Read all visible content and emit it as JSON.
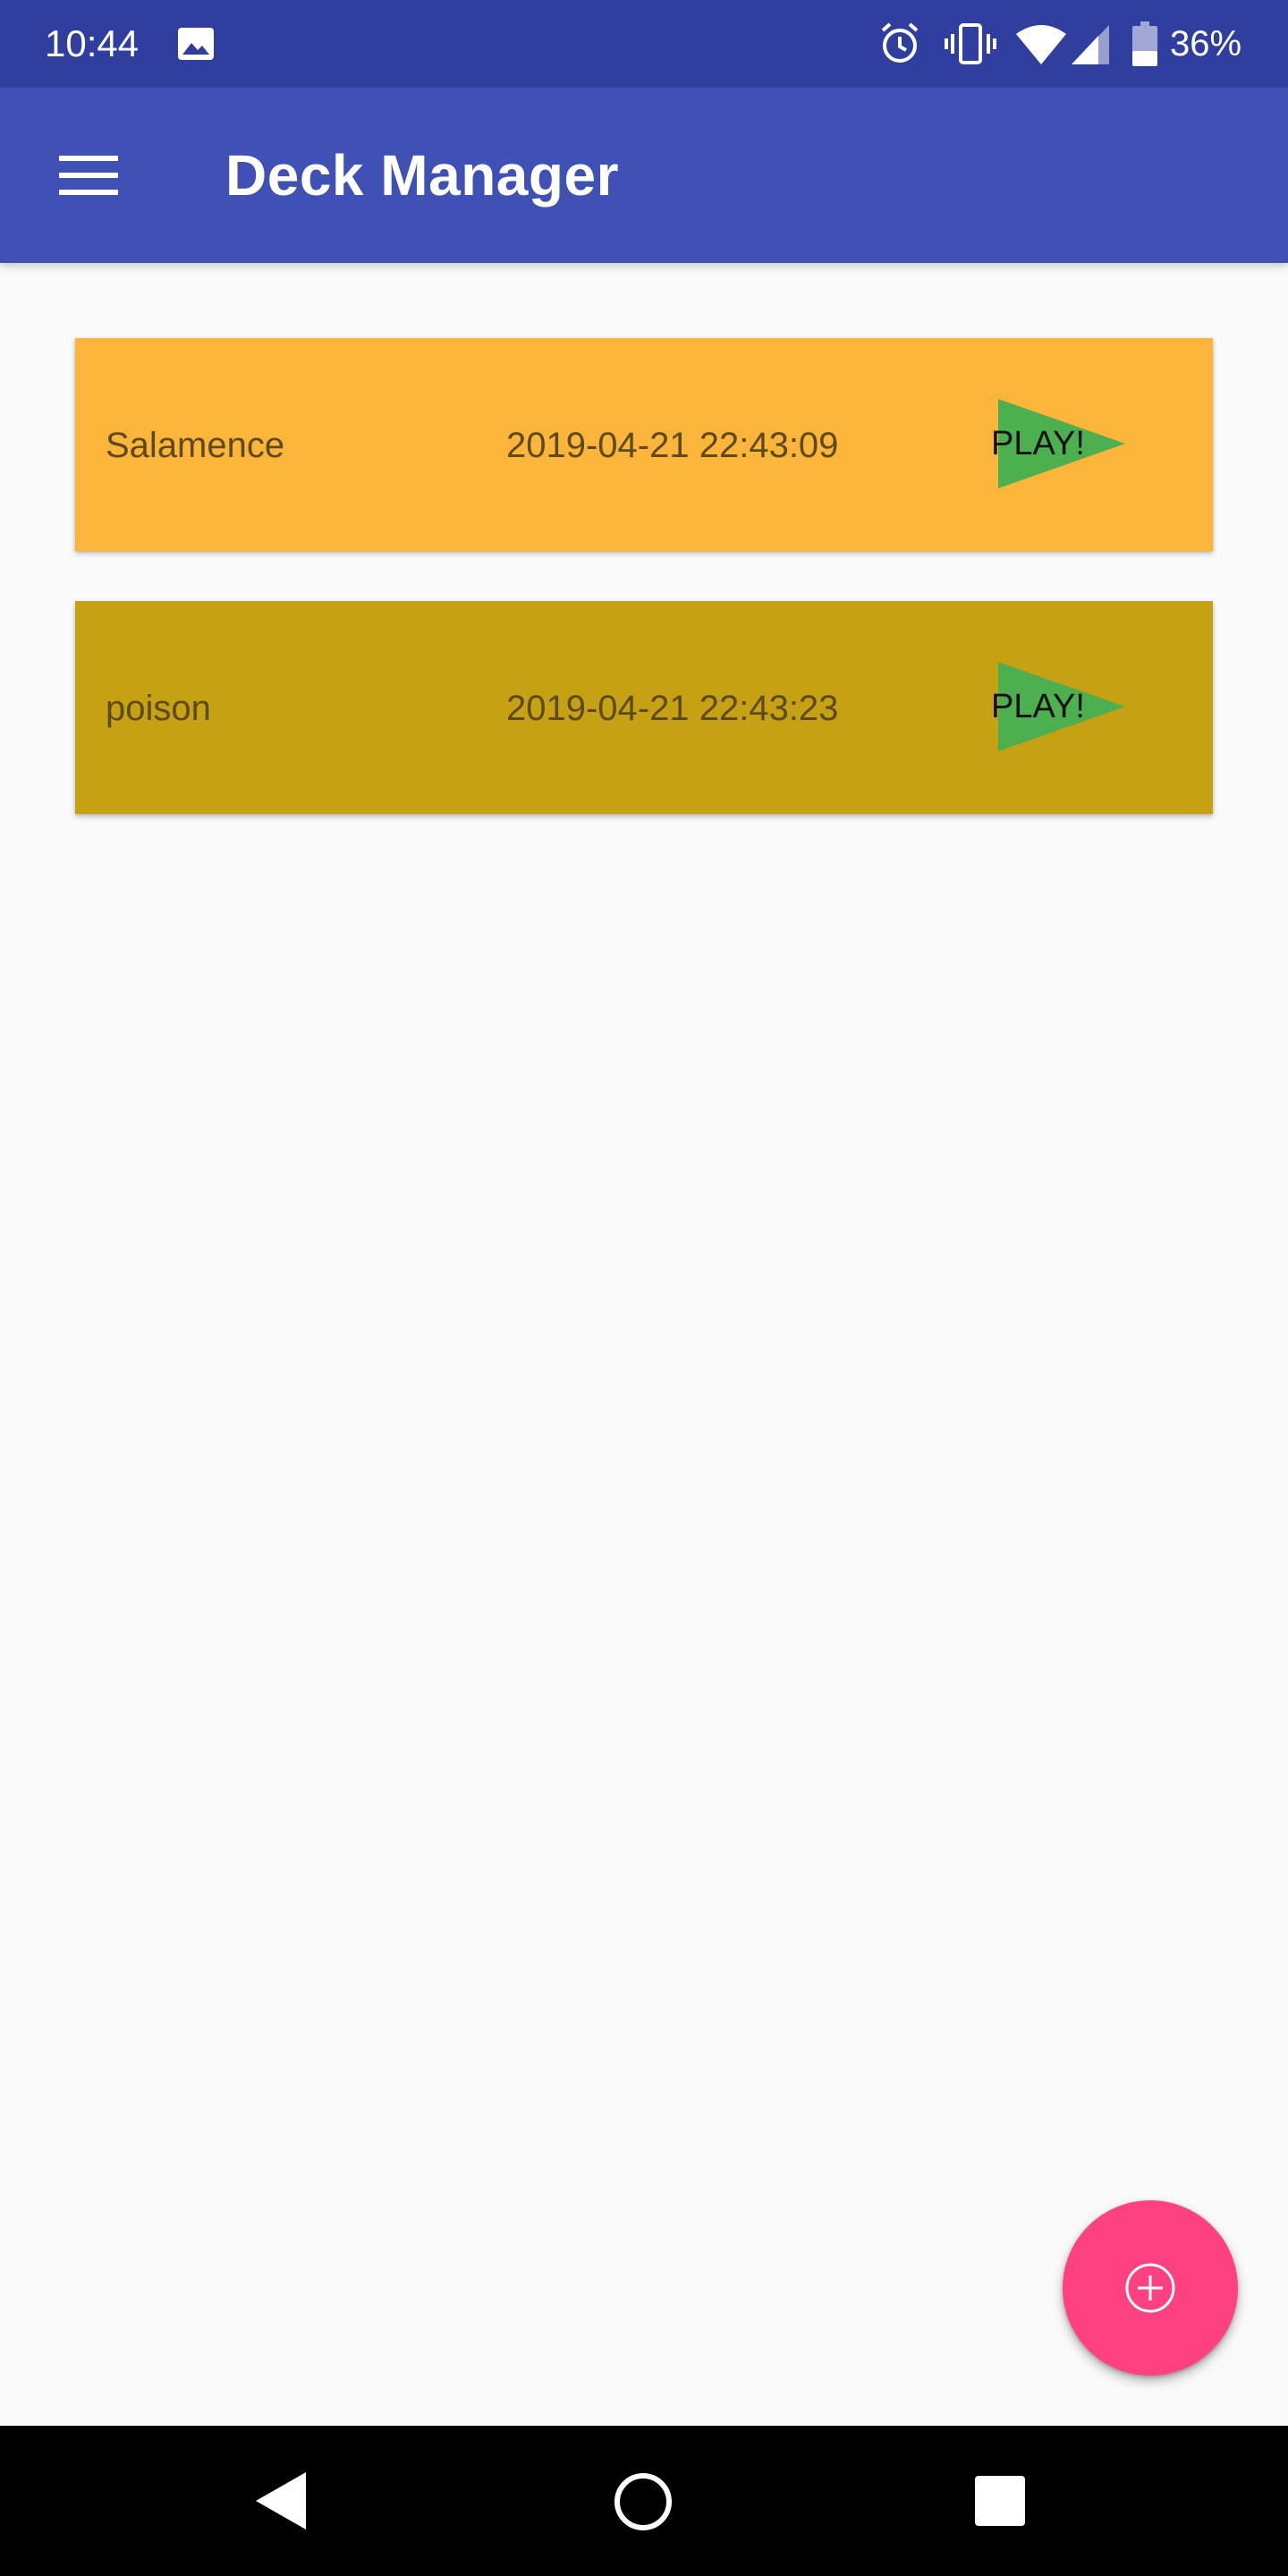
{
  "status_bar": {
    "time": "10:44",
    "battery": "36%",
    "icons": [
      "photo-icon",
      "alarm-icon",
      "vibrate-icon",
      "wifi-icon",
      "signal-icon",
      "battery-icon"
    ]
  },
  "app_bar": {
    "title": "Deck Manager",
    "menu_icon": "menu-icon"
  },
  "decks": [
    {
      "name": "Salamence",
      "date": "2019-04-21 22:43:09",
      "play_label": "PLAY!",
      "color": "#fbb53a"
    },
    {
      "name": "poison",
      "date": "2019-04-21 22:43:23",
      "play_label": "PLAY!",
      "color": "#c6a114"
    }
  ],
  "colors": {
    "status_bar": "#303f9f",
    "app_bar": "#3f51b5",
    "play_triangle": "#4caf50",
    "fab": "#ff4081",
    "background": "#fafafa"
  },
  "fab": {
    "icon": "add-circle-icon"
  },
  "nav_bar": {
    "icons": [
      "back-icon",
      "home-icon",
      "recents-icon"
    ]
  }
}
